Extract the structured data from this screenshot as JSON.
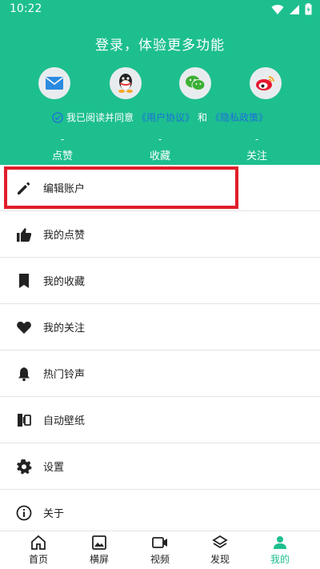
{
  "status_bar": {
    "time": "10:22"
  },
  "header": {
    "title": "登录，体验更多功能",
    "agreement": {
      "prefix": "我已阅读并同意",
      "user_agreement": "《用户协议》",
      "and": "和",
      "privacy_policy": "《隐私政策》"
    },
    "stats": [
      {
        "value": "-",
        "label": "点赞"
      },
      {
        "value": "-",
        "label": "收藏"
      },
      {
        "value": "-",
        "label": "关注"
      }
    ],
    "social_icons": [
      "email-icon",
      "qq-icon",
      "wechat-icon",
      "weibo-icon"
    ]
  },
  "menu": {
    "items": [
      {
        "label": "编辑账户",
        "icon": "pencil-icon"
      },
      {
        "label": "我的点赞",
        "icon": "thumbs-up-icon"
      },
      {
        "label": "我的收藏",
        "icon": "bookmark-icon"
      },
      {
        "label": "我的关注",
        "icon": "heart-icon"
      },
      {
        "label": "热门铃声",
        "icon": "bell-icon"
      },
      {
        "label": "自动壁纸",
        "icon": "wallpaper-icon"
      },
      {
        "label": "设置",
        "icon": "gear-icon"
      },
      {
        "label": "关于",
        "icon": "info-icon"
      }
    ]
  },
  "bottom_nav": {
    "tabs": [
      {
        "label": "首页",
        "icon": "home-icon"
      },
      {
        "label": "横屏",
        "icon": "image-icon"
      },
      {
        "label": "视频",
        "icon": "video-icon"
      },
      {
        "label": "发现",
        "icon": "layers-icon"
      },
      {
        "label": "我的",
        "icon": "person-icon"
      }
    ],
    "active_index": 4
  },
  "colors": {
    "brand_green": "#1dbf8f",
    "link_blue": "#1e6fd9",
    "highlight_red": "#e01e2a"
  }
}
